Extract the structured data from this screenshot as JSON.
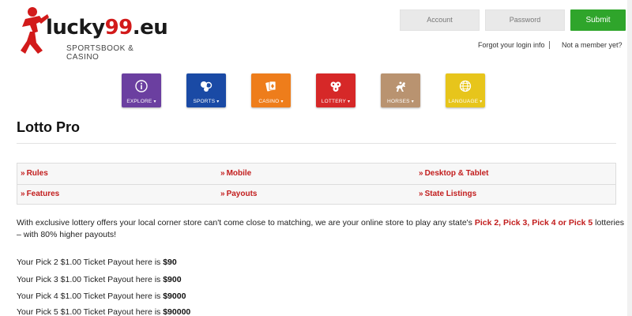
{
  "logo": {
    "prefix": "lucky",
    "number": "99",
    "suffix": ".eu",
    "tagline": "SPORTSBOOK & CASINO",
    "brand_red": "#d21a1a"
  },
  "login": {
    "account_placeholder": "Account",
    "password_placeholder": "Password",
    "submit_label": "Submit",
    "forgot_label": "Forgot your login info",
    "not_member_label": "Not a member yet?",
    "submit_color": "#2fa52b"
  },
  "nav": {
    "tiles": [
      {
        "label": "EXPLORE",
        "icon": "info-icon",
        "color": "#6b3fa0"
      },
      {
        "label": "SPORTS",
        "icon": "sports-balls-icon",
        "color": "#1a4aa5"
      },
      {
        "label": "CASINO",
        "icon": "cards-icon",
        "color": "#ee7d1b"
      },
      {
        "label": "LOTTERY",
        "icon": "lottery-balls-icon",
        "color": "#d62828"
      },
      {
        "label": "HORSES",
        "icon": "horse-icon",
        "color": "#b99370"
      },
      {
        "label": "LANGUAGE",
        "icon": "globe-icon",
        "color": "#e7c51b"
      }
    ]
  },
  "page": {
    "title": "Lotto Pro"
  },
  "links": {
    "row1": [
      "Rules",
      "Mobile",
      "Desktop & Tablet"
    ],
    "row2": [
      "Features",
      "Payouts",
      "State Listings"
    ],
    "marker": "»"
  },
  "intro": {
    "text_before": "With exclusive lottery offers your local corner store can't come close to matching, we are your online store to play any state's ",
    "highlight": "Pick 2, Pick 3, Pick 4 or Pick 5",
    "text_after": " lotteries – with 80% higher payouts!"
  },
  "payouts": [
    {
      "text": "Your Pick 2 $1.00 Ticket Payout here is ",
      "amount": "$90"
    },
    {
      "text": "Your Pick 3 $1.00 Ticket Payout here is ",
      "amount": "$900"
    },
    {
      "text": "Your Pick 4 $1.00 Ticket Payout here is ",
      "amount": "$9000"
    },
    {
      "text": "Your Pick 5 $1.00 Ticket Payout here is ",
      "amount": "$90000"
    }
  ]
}
